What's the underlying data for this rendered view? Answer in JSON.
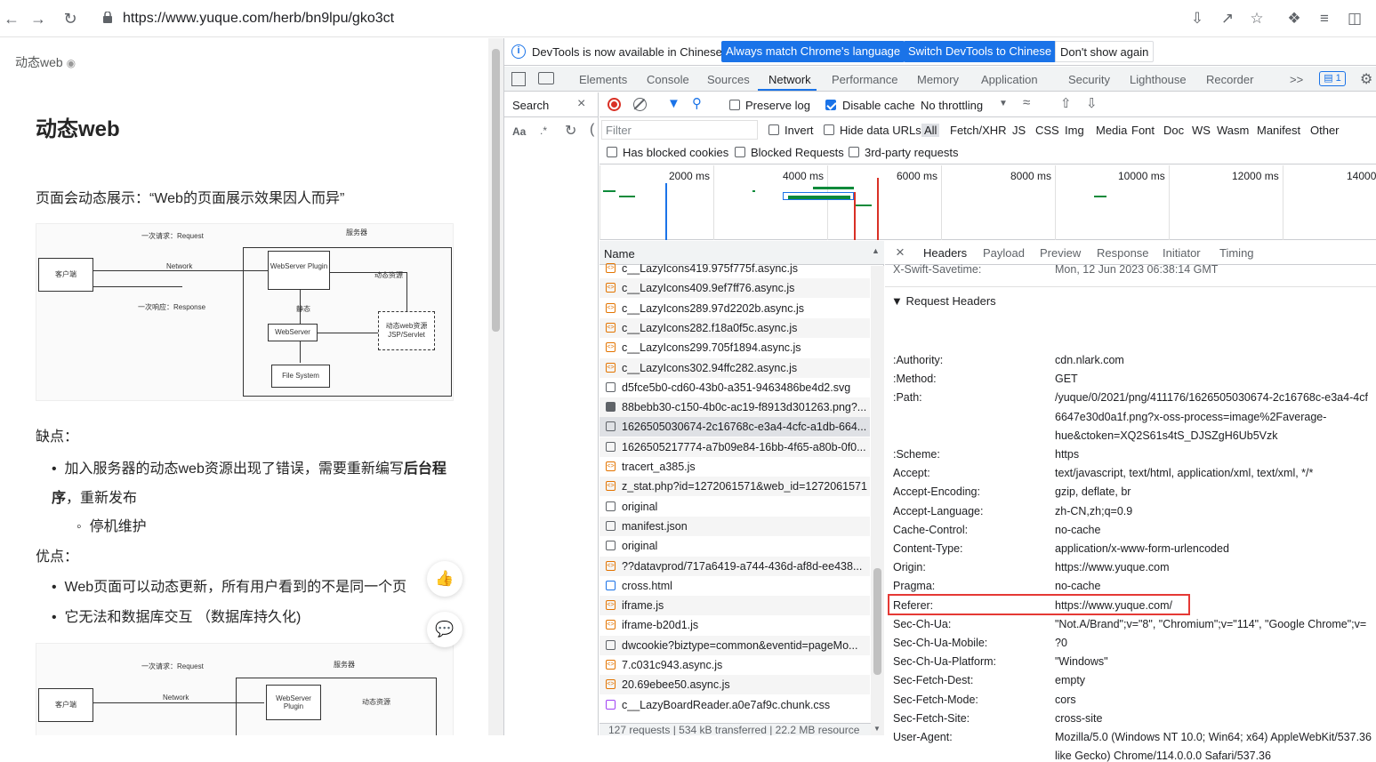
{
  "browser": {
    "url": "https://www.yuque.com/herb/bn9lpu/gko3ct"
  },
  "page": {
    "breadcrumb": "动态web",
    "title": "动态web",
    "intro": "页面会动态展示：“Web的页面展示效果因人而异”",
    "figure": {
      "request_label": "一次请求：Request",
      "response_label": "一次响应：Response",
      "server_label": "服务器",
      "client": "客户端",
      "network": "Network",
      "plugin": "WebServer Plugin",
      "webserver": "WebServer",
      "dynamic_res": "动态资源",
      "static_label": "静态",
      "servlet": "动态web资源 JSP/Servlet",
      "filesystem": "File System"
    },
    "cons_title": "缺点：",
    "cons_item_a": "加入服务器的动态web资源出现了错误，需要重新编写",
    "cons_item_bold": "后台程序",
    "cons_item_b": "，重新发布",
    "cons_sub": "停机维护",
    "pros_title": "优点：",
    "pros_item1": "Web页面可以动态更新，所有用户看到的不是同一个页",
    "pros_item2": "它无法和数据库交互 （数据库持久化)"
  },
  "devtools": {
    "info_msg": "DevTools is now available in Chinese!",
    "btn_match": "Always match Chrome's language",
    "btn_switch": "Switch DevTools to Chinese",
    "btn_dismiss": "Don't show again",
    "tabs": [
      "Elements",
      "Console",
      "Sources",
      "Network",
      "Performance",
      "Memory",
      "Application",
      "Security",
      "Lighthouse",
      "Recorder"
    ],
    "more_tabs": ">>",
    "issues_count": "1",
    "search_label": "Search",
    "preserve_log": "Preserve log",
    "disable_cache": "Disable cache",
    "throttling": "No throttling",
    "filter_placeholder": "Filter",
    "invert": "Invert",
    "hide_data_urls": "Hide data URLs",
    "types": [
      "All",
      "Fetch/XHR",
      "JS",
      "CSS",
      "Img",
      "Media",
      "Font",
      "Doc",
      "WS",
      "Wasm",
      "Manifest",
      "Other"
    ],
    "has_blocked": "Has blocked cookies",
    "blocked_requests": "Blocked Requests",
    "third_party": "3rd-party requests",
    "ticks": [
      "2000 ms",
      "4000 ms",
      "6000 ms",
      "8000 ms",
      "10000 ms",
      "12000 ms",
      "14000"
    ],
    "name_header": "Name",
    "requests": [
      {
        "name": "c__LazyIcons419.975f775f.async.js",
        "type": "js"
      },
      {
        "name": "c__LazyIcons409.9ef7ff76.async.js",
        "type": "js"
      },
      {
        "name": "c__LazyIcons289.97d2202b.async.js",
        "type": "js"
      },
      {
        "name": "c__LazyIcons282.f18a0f5c.async.js",
        "type": "js"
      },
      {
        "name": "c__LazyIcons299.705f1894.async.js",
        "type": "js"
      },
      {
        "name": "c__LazyIcons302.94ffc282.async.js",
        "type": "js"
      },
      {
        "name": "d5fce5b0-cd60-43b0-a351-9463486be4d2.svg",
        "type": "doc"
      },
      {
        "name": "88bebb30-c150-4b0c-ac19-f8913d301263.png?...",
        "type": "img"
      },
      {
        "name": "1626505030674-2c16768c-e3a4-4cfc-a1db-664...",
        "type": "doc"
      },
      {
        "name": "1626505217774-a7b09e84-16bb-4f65-a80b-0f0...",
        "type": "doc"
      },
      {
        "name": "tracert_a385.js",
        "type": "js"
      },
      {
        "name": "z_stat.php?id=1272061571&web_id=1272061571",
        "type": "js"
      },
      {
        "name": "original",
        "type": "doc"
      },
      {
        "name": "manifest.json",
        "type": "doc"
      },
      {
        "name": "original",
        "type": "doc"
      },
      {
        "name": "??datavprod/717a6419-a744-436d-af8d-ee438...",
        "type": "js"
      },
      {
        "name": "cross.html",
        "type": "html"
      },
      {
        "name": "iframe.js",
        "type": "js"
      },
      {
        "name": "iframe-b20d1.js",
        "type": "js"
      },
      {
        "name": "dwcookie?biztype=common&eventid=pageMo...",
        "type": "doc"
      },
      {
        "name": "7.c031c943.async.js",
        "type": "js"
      },
      {
        "name": "20.69ebee50.async.js",
        "type": "js"
      },
      {
        "name": "c__LazyBoardReader.a0e7af9c.chunk.css",
        "type": "css"
      }
    ],
    "status": "127 requests | 534 kB transferred | 22.2 MB resource",
    "detail_tabs": [
      "Headers",
      "Payload",
      "Preview",
      "Response",
      "Initiator",
      "Timing"
    ],
    "partial_key": "X-Swift-Savetime:",
    "partial_val": "Mon, 12 Jun 2023 06:38:14 GMT",
    "section": "▼ Request Headers",
    "headers": [
      {
        "k": ":Authority:",
        "v": "cdn.nlark.com"
      },
      {
        "k": ":Method:",
        "v": "GET"
      },
      {
        "k": ":Path:",
        "v": "/yuque/0/2021/png/411176/1626505030674-2c16768c-e3a4-4cf"
      },
      {
        "k": "",
        "v": "6647e30d0a1f.png?x-oss-process=image%2Faverage-"
      },
      {
        "k": "",
        "v": "hue&ctoken=XQ2S61s4tS_DJSZgH6Ub5Vzk"
      },
      {
        "k": ":Scheme:",
        "v": "https"
      },
      {
        "k": "Accept:",
        "v": "text/javascript, text/html, application/xml, text/xml, */*"
      },
      {
        "k": "Accept-Encoding:",
        "v": "gzip, deflate, br"
      },
      {
        "k": "Accept-Language:",
        "v": "zh-CN,zh;q=0.9"
      },
      {
        "k": "Cache-Control:",
        "v": "no-cache"
      },
      {
        "k": "Content-Type:",
        "v": "application/x-www-form-urlencoded"
      },
      {
        "k": "Origin:",
        "v": "https://www.yuque.com"
      },
      {
        "k": "Pragma:",
        "v": "no-cache"
      },
      {
        "k": "Referer:",
        "v": "https://www.yuque.com/"
      },
      {
        "k": "Sec-Ch-Ua:",
        "v": "\"Not.A/Brand\";v=\"8\", \"Chromium\";v=\"114\", \"Google Chrome\";v="
      },
      {
        "k": "Sec-Ch-Ua-Mobile:",
        "v": "?0"
      },
      {
        "k": "Sec-Ch-Ua-Platform:",
        "v": "\"Windows\""
      },
      {
        "k": "Sec-Fetch-Dest:",
        "v": "empty"
      },
      {
        "k": "Sec-Fetch-Mode:",
        "v": "cors"
      },
      {
        "k": "Sec-Fetch-Site:",
        "v": "cross-site"
      },
      {
        "k": "User-Agent:",
        "v": "Mozilla/5.0 (Windows NT 10.0; Win64; x64) AppleWebKit/537.36"
      },
      {
        "k": "",
        "v": "like Gecko) Chrome/114.0.0.0 Safari/537.36"
      }
    ]
  }
}
